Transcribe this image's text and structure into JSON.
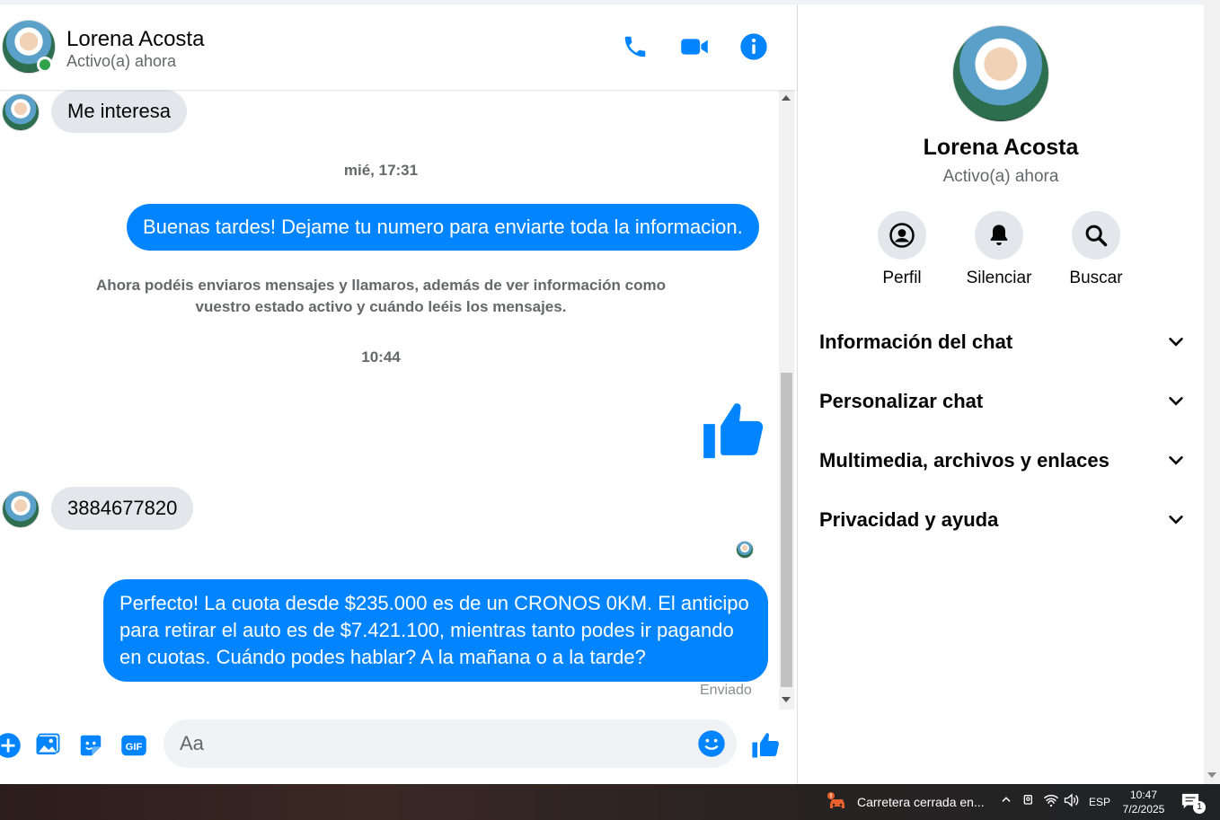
{
  "contact": {
    "name": "Lorena Acosta",
    "status": "Activo(a) ahora"
  },
  "messages": [
    {
      "type": "in",
      "text": "Me interesa"
    },
    {
      "type": "timestamp",
      "text": "mié, 17:31"
    },
    {
      "type": "out",
      "text": "Buenas tardes! Dejame tu numero para enviarte toda la informacion."
    },
    {
      "type": "system",
      "text": "Ahora podéis enviaros mensajes y llamaros, además de ver información como vuestro estado activo y cuándo leéis los mensajes."
    },
    {
      "type": "timestamp",
      "text": "10:44"
    },
    {
      "type": "like"
    },
    {
      "type": "in",
      "text": "3884677820"
    },
    {
      "type": "out",
      "text": "Perfecto! La cuota desde $235.000 es de un CRONOS 0KM. El anticipo para retirar el auto es de $7.421.100, mientras tanto podes ir pagando en cuotas. Cuándo podes hablar? A la mañana o a la tarde?"
    }
  ],
  "sent_label": "Enviado",
  "composer": {
    "placeholder": "Aa"
  },
  "sidebar": {
    "actions": [
      {
        "label": "Perfil",
        "icon": "profile-icon"
      },
      {
        "label": "Silenciar",
        "icon": "bell-icon"
      },
      {
        "label": "Buscar",
        "icon": "search-icon"
      }
    ],
    "sections": [
      {
        "label": "Información del chat"
      },
      {
        "label": "Personalizar chat"
      },
      {
        "label": "Multimedia, archivos y enlaces"
      },
      {
        "label": "Privacidad y ayuda"
      }
    ]
  },
  "taskbar": {
    "weather": "Carretera cerrada en...",
    "language": "ESP",
    "time": "10:47",
    "date": "7/2/2025",
    "notifications": "1"
  },
  "colors": {
    "accent": "#0084ff",
    "online": "#31a24c",
    "bubble_in": "#e4e6eb"
  }
}
